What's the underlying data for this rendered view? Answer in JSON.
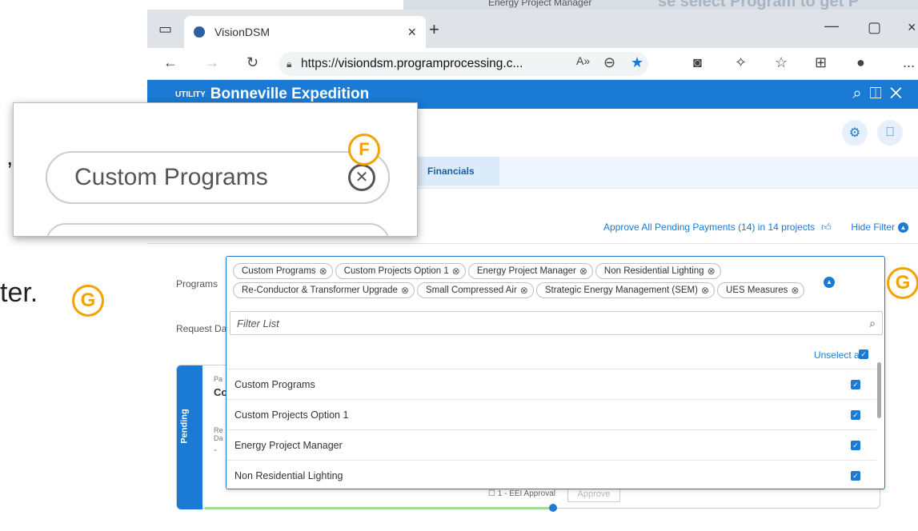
{
  "doc": {
    "comma": ",",
    "ter": "ter."
  },
  "badges": {
    "f": "F",
    "g": "G"
  },
  "top_strip": {
    "a": "Energy Project Manager",
    "b": "se select Program to get P"
  },
  "browser": {
    "tab_title": "VisionDSM",
    "url_prefix": "https://",
    "url_main": "visiondsm.programprocessing.c...",
    "new_tab": "+",
    "more": "..."
  },
  "app": {
    "section": "UTILITY",
    "title": "Bonneville Expedition",
    "tab_active": "Financials"
  },
  "actions": {
    "approve_all": "Approve All Pending Payments (14) in 14 projects",
    "hide_filter": "Hide Filter"
  },
  "labels": {
    "programs": "Programs",
    "request_date": "Request Da"
  },
  "chips": [
    "Custom Programs",
    "Custom Projects Option 1",
    "Energy Project Manager",
    "Non Residential Lighting",
    "Re-Conductor & Transformer Upgrade",
    "Small Compressed Air",
    "Strategic Energy Management (SEM)",
    "UES Measures"
  ],
  "filter": {
    "placeholder": "Filter List",
    "unselect_all": "Unselect all"
  },
  "options": [
    "Custom Programs",
    "Custom Projects Option 1",
    "Energy Project Manager",
    "Non Residential Lighting"
  ],
  "card": {
    "status": "Pending",
    "frag_pa": "Pa",
    "frag_co": "Co",
    "frag_re": "Re",
    "frag_da": "Da",
    "frag_dash": "-",
    "ee_approval": "1 - EEI Approval",
    "approve": "Approve"
  },
  "inset": {
    "chip_label": "Custom Programs"
  }
}
